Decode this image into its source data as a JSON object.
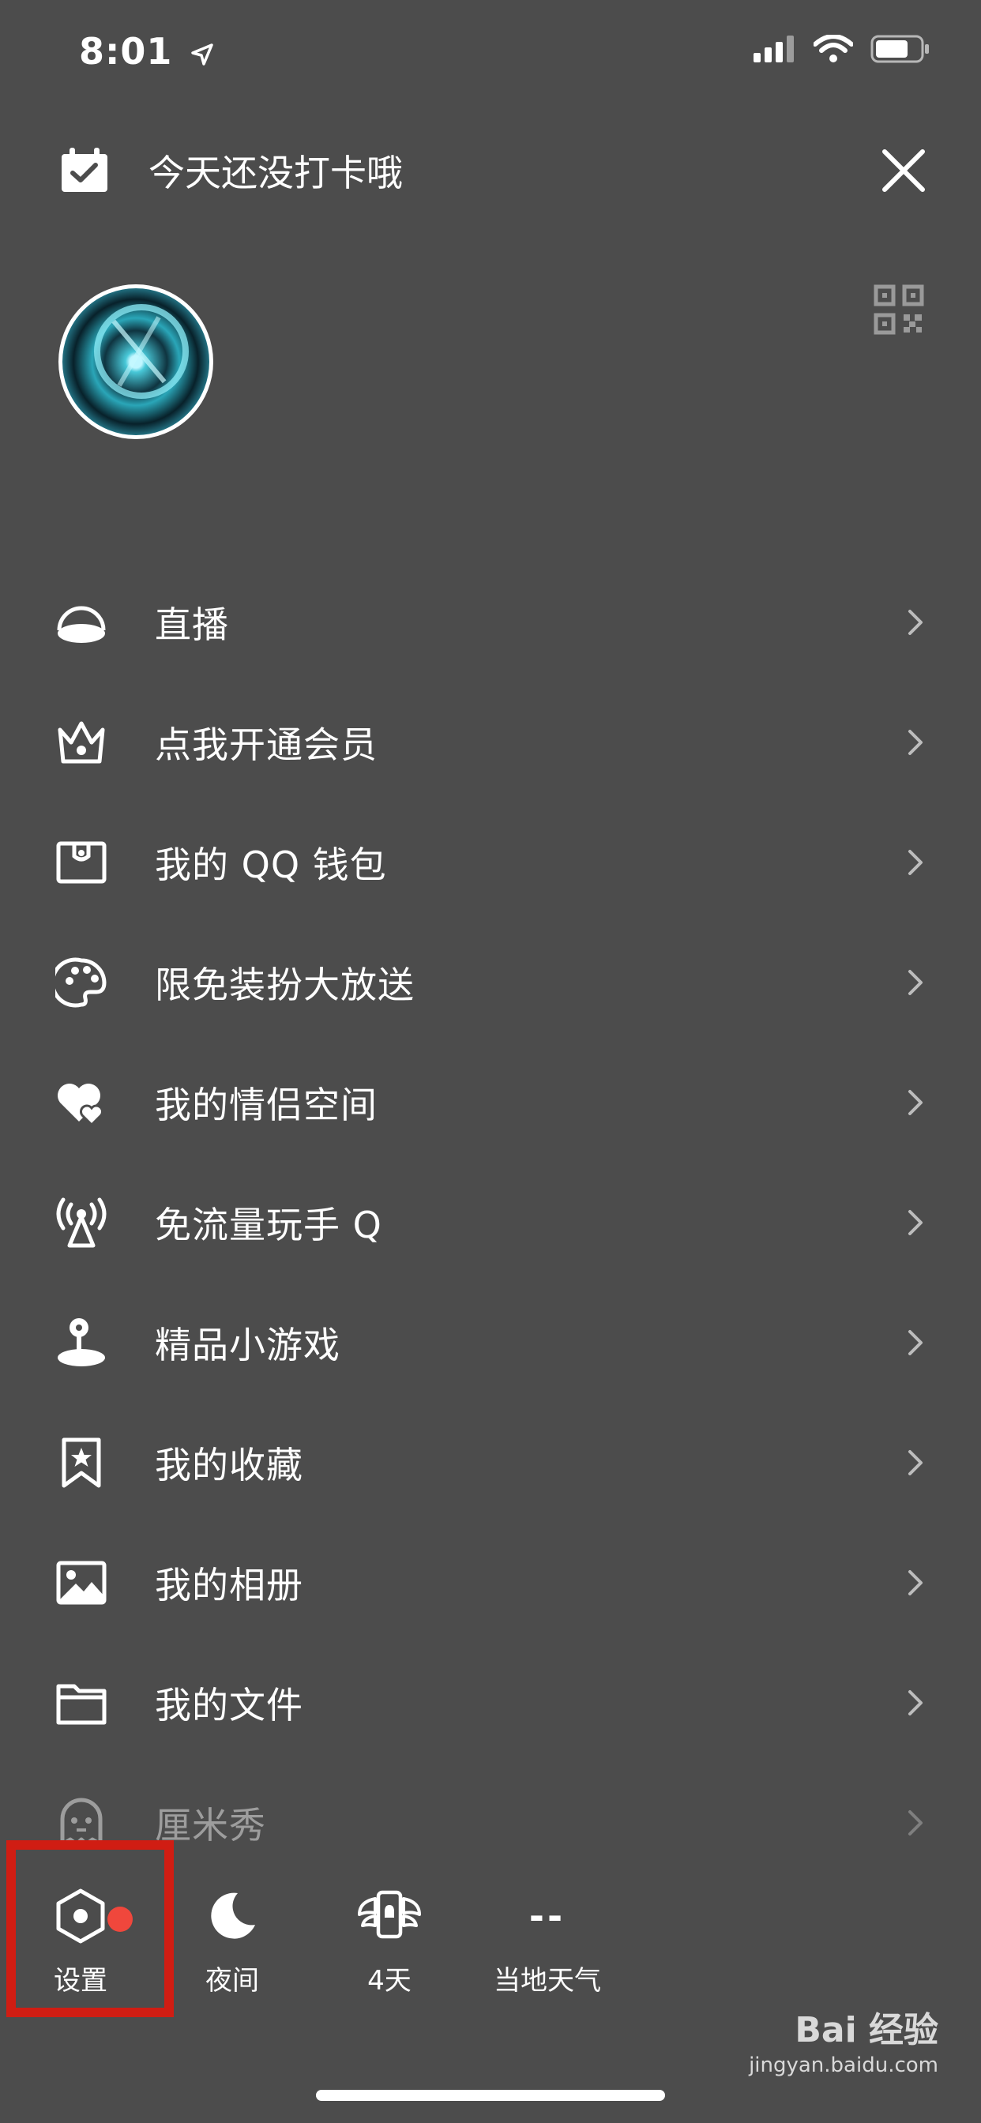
{
  "status_bar": {
    "time": "8:01"
  },
  "header": {
    "checkin_text": "今天还没打卡哦"
  },
  "menu": {
    "items": [
      {
        "label": "直播",
        "icon": "live-icon"
      },
      {
        "label": "点我开通会员",
        "icon": "crown-icon"
      },
      {
        "label": "我的 QQ 钱包",
        "icon": "wallet-icon"
      },
      {
        "label": "限免装扮大放送",
        "icon": "palette-icon"
      },
      {
        "label": "我的情侣空间",
        "icon": "hearts-icon"
      },
      {
        "label": "免流量玩手 Q",
        "icon": "signal-tower-icon"
      },
      {
        "label": "精品小游戏",
        "icon": "joystick-icon"
      },
      {
        "label": "我的收藏",
        "icon": "bookmark-star-icon"
      },
      {
        "label": "我的相册",
        "icon": "photo-icon"
      },
      {
        "label": "我的文件",
        "icon": "folder-icon"
      },
      {
        "label": "厘米秀",
        "icon": "ghost-icon"
      }
    ]
  },
  "bottom_bar": {
    "settings_label": "设置",
    "night_label": "夜间",
    "days_label": "4天",
    "weather_value": "--",
    "weather_label": "当地天气"
  },
  "watermark": {
    "brand": "Bai  经验",
    "url": "jingyan.baidu.com"
  },
  "colors": {
    "background": "#4c4c4c",
    "badge": "#f0473c",
    "highlight": "#d01d13"
  }
}
